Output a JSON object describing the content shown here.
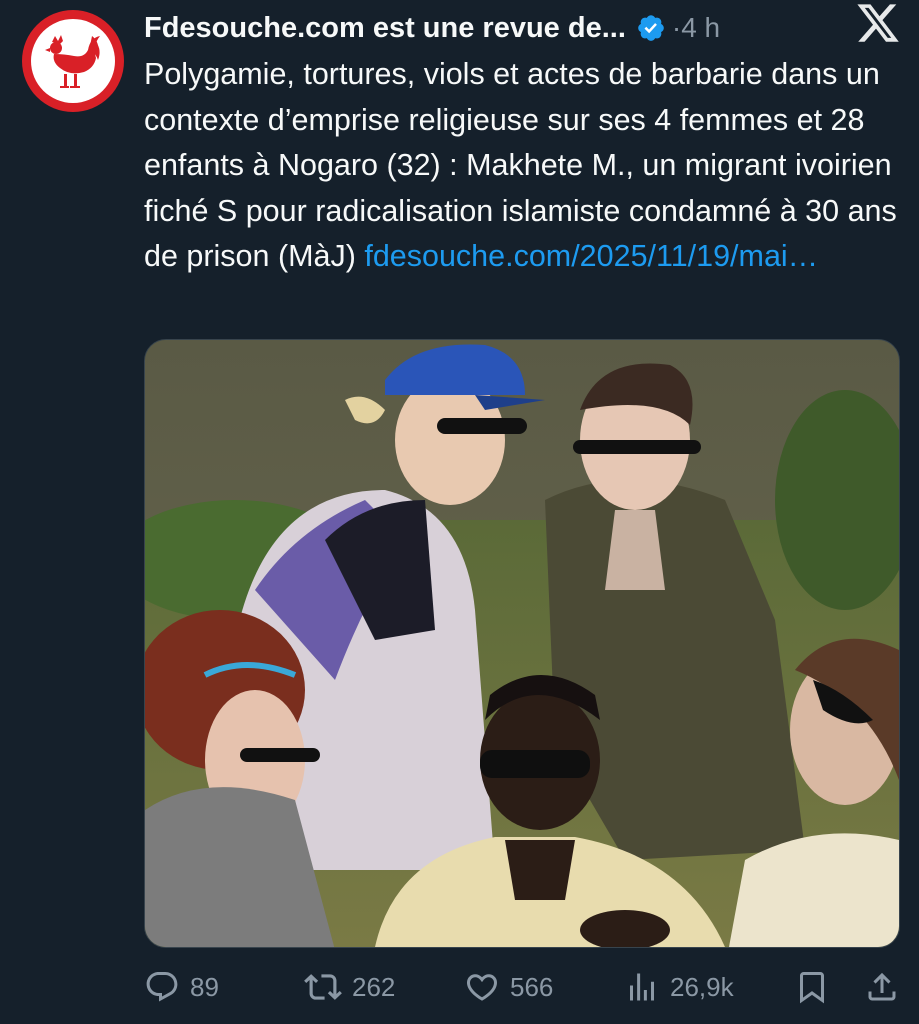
{
  "tweet": {
    "author_name": "Fdesouche.com est une revue de...",
    "time": "·4 h",
    "text": "Polygamie, tortures, viols et actes de barbarie dans un contexte d’emprise religieuse sur ses 4 femmes et 28 enfants à Nogaro (32) : Makhete M., un migrant ivoirien fiché S pour radicalisation islamiste condamné à 30 ans de prison (MàJ) ",
    "link": "fdesouche.com/2025/11/19/mai…"
  },
  "actions": {
    "replies": "89",
    "retweets": "262",
    "likes": "566",
    "views": "26,9k"
  },
  "colors": {
    "background": "#15202b",
    "accent": "#1d9bf0",
    "muted": "#8b98a5",
    "avatar_red": "#d92027"
  },
  "icons": [
    "rooster-logo",
    "verified-badge-icon",
    "x-logo-icon",
    "reply-icon",
    "retweet-icon",
    "like-icon",
    "views-icon",
    "bookmark-icon",
    "share-icon"
  ]
}
